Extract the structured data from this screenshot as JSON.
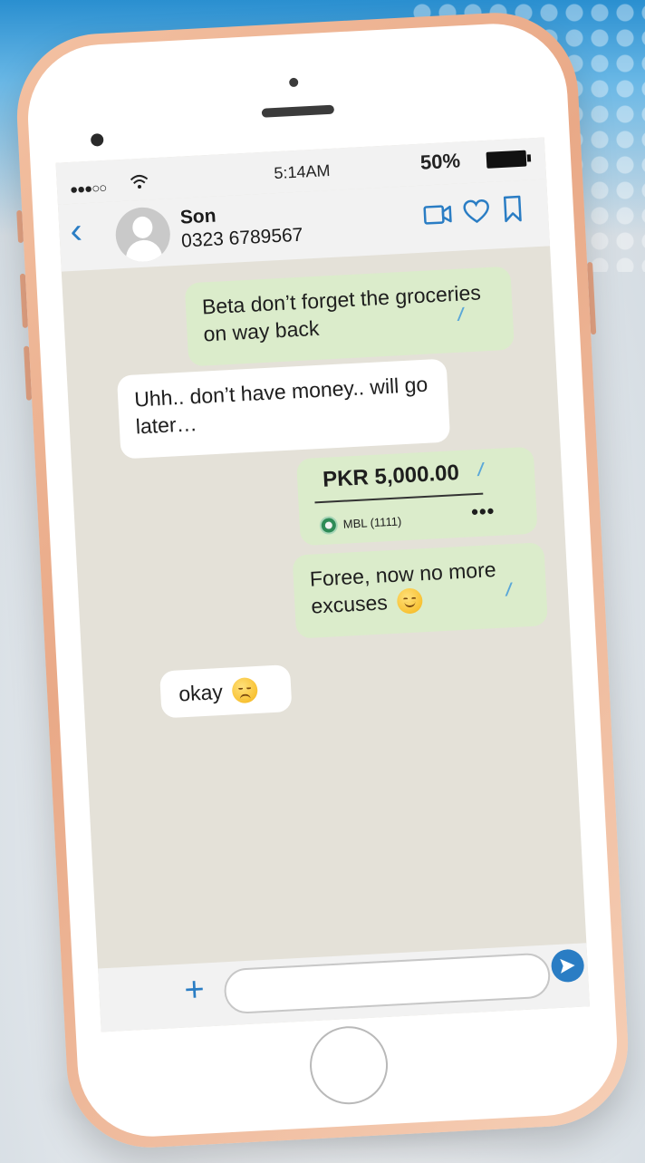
{
  "status_bar": {
    "signal": "●●●○○",
    "time": "5:14AM",
    "battery_percent": "50%"
  },
  "header": {
    "contact_name": "Son",
    "contact_phone": "0323 6789567"
  },
  "messages": [
    {
      "direction": "outgoing",
      "text": "Beta don’t forget the groceries on way back",
      "status": "read"
    },
    {
      "direction": "incoming",
      "text": "Uhh.. don’t have money.. will go later…"
    },
    {
      "direction": "outgoing",
      "type": "payment",
      "amount": "PKR 5,000.00",
      "account": "MBL (1111)",
      "status": "read"
    },
    {
      "direction": "outgoing",
      "text": "Foree, now no more excuses",
      "emoji": "smiling-face",
      "status": "read"
    },
    {
      "direction": "incoming",
      "text": "okay",
      "emoji": "pensive-face"
    }
  ],
  "input": {
    "placeholder": "",
    "value": ""
  },
  "colors": {
    "accent": "#2a7dc4",
    "outgoing_bubble": "#dbeccb",
    "incoming_bubble": "#ffffff",
    "chat_background": "#e4e1d8",
    "phone_frame": "#e9a987"
  }
}
